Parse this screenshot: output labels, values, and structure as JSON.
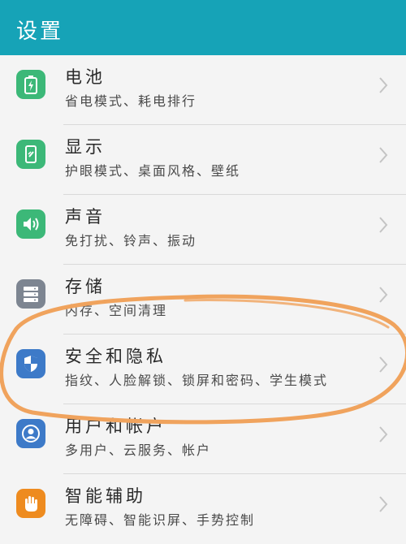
{
  "header": {
    "title": "设置"
  },
  "colors": {
    "header_bg": "#16a3b7",
    "green_icon": "#3cb878",
    "gray_icon": "#7d8591",
    "blue_icon": "#3d7ac8",
    "orange_icon": "#ee8b1f",
    "annotation_ellipse": "#f0a35d"
  },
  "settings": {
    "items": [
      {
        "title": "电池",
        "subtitle": "省电模式、耗电排行",
        "icon": "battery-icon"
      },
      {
        "title": "显示",
        "subtitle": "护眼模式、桌面风格、壁纸",
        "icon": "display-icon"
      },
      {
        "title": "声音",
        "subtitle": "免打扰、铃声、振动",
        "icon": "sound-icon"
      },
      {
        "title": "存储",
        "subtitle": "内存、空间清理",
        "icon": "storage-icon"
      },
      {
        "title": "安全和隐私",
        "subtitle": "指纹、人脸解锁、锁屏和密码、学生模式",
        "icon": "shield-icon"
      },
      {
        "title": "用户和帐户",
        "subtitle": "多用户、云服务、帐户",
        "icon": "user-icon"
      },
      {
        "title": "智能辅助",
        "subtitle": "无障碍、智能识屏、手势控制",
        "icon": "hand-icon"
      }
    ]
  }
}
